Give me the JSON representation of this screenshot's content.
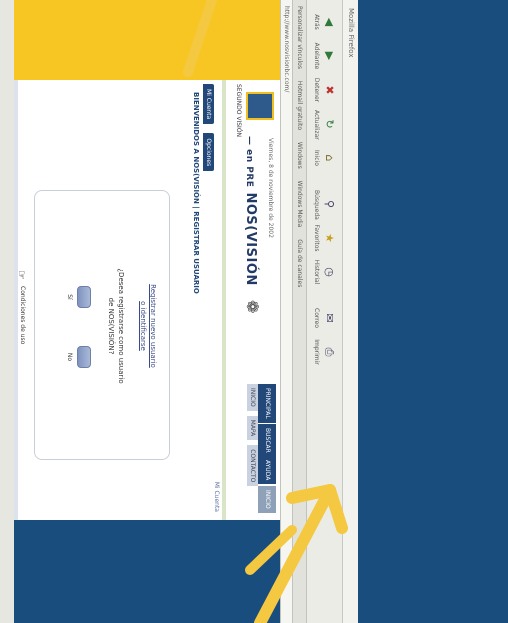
{
  "browser": {
    "title": "Mozilla Firefox",
    "toolbar": [
      {
        "label": "Atrás",
        "icon": "back-arrow-icon"
      },
      {
        "label": "Adelante",
        "icon": "forward-arrow-icon"
      },
      {
        "label": "Detener",
        "icon": "stop-icon"
      },
      {
        "label": "Actualizar",
        "icon": "refresh-icon"
      },
      {
        "label": "Inicio",
        "icon": "home-icon"
      },
      {
        "label": "Búsqueda",
        "icon": "search-icon"
      },
      {
        "label": "Favoritos",
        "icon": "favorites-icon"
      },
      {
        "label": "Historial",
        "icon": "history-icon"
      },
      {
        "label": "Correo",
        "icon": "mail-icon"
      },
      {
        "label": "Imprimir",
        "icon": "print-icon"
      }
    ],
    "links": [
      "Personalizar vínculos",
      "Hotmail gratuito",
      "Windows",
      "Windows Media",
      "Guía de canales"
    ],
    "address": "http://www.nosvisionbc.com/"
  },
  "page": {
    "logo_text": "SEGUNDO VISIÓN",
    "date": "Viernes, 8 de noviembre de 2002",
    "brand": "NOS(VISIÓN",
    "brand_prefix": "— en PRE",
    "nav_tabs": [
      "PRINCIPAL",
      "BUSCAR",
      "AYUDA",
      "INICIO"
    ],
    "sub_nav": [
      "INICIO",
      "MAPA",
      "CONTACTO"
    ],
    "blue_tabs": [
      "Mi Cuenta",
      "Opciones"
    ],
    "right_link": "Mi Cuenta",
    "section_title": "BIENVENIDOS A NOS(VISIÓN | REGISTRAR USUARIO",
    "dialog": {
      "link1": "Registrar nuevo usuario",
      "link2": "o identificarse",
      "question1": "¿Desea registrarse como usuario",
      "question2": "de NOS(VISIÓN?",
      "btn_yes": "Sí",
      "btn_no": "No"
    },
    "footer": "Condiciones de uso"
  },
  "colors": {
    "accent_blue": "#22487a",
    "yellow": "#f7c623",
    "backdrop": "#184d7e",
    "arrow": "#f5c842"
  }
}
